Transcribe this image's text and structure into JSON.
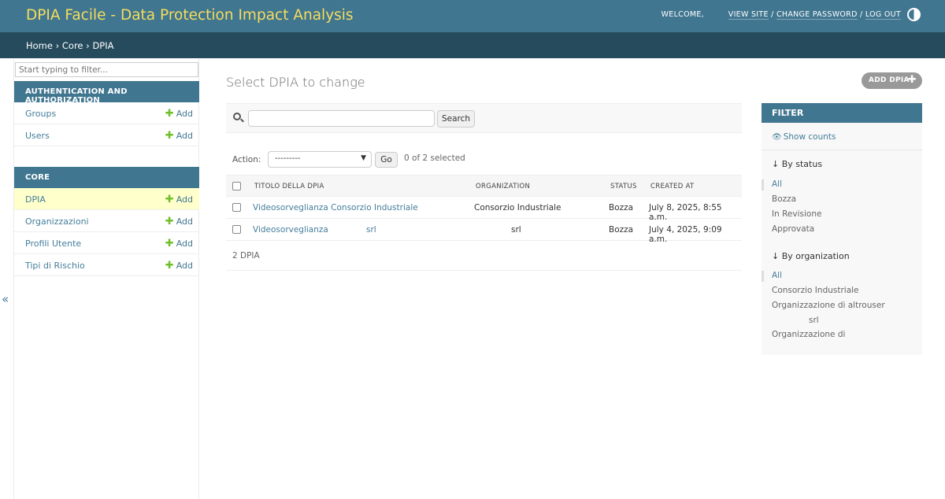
{
  "header": {
    "site_title": "DPIA Facile - Data Protection Impact Analysis",
    "welcome": "WELCOME,",
    "view_site": "VIEW SITE",
    "change_password": "CHANGE PASSWORD",
    "log_out": "LOG OUT",
    "separator": " / "
  },
  "breadcrumbs": {
    "home": "Home",
    "core": "Core",
    "current": "DPIA",
    "sep": " › "
  },
  "sidebar": {
    "filter_placeholder": "Start typing to filter...",
    "collapse": "«",
    "apps": [
      {
        "caption": "AUTHENTICATION AND AUTHORIZATION",
        "models": [
          {
            "name": "Groups",
            "add": "Add"
          },
          {
            "name": "Users",
            "add": "Add"
          }
        ]
      },
      {
        "caption": "CORE",
        "models": [
          {
            "name": "DPIA",
            "add": "Add"
          },
          {
            "name": "Organizzazioni",
            "add": "Add"
          },
          {
            "name": "Profili Utente",
            "add": "Add"
          },
          {
            "name": "Tipi di Rischio",
            "add": "Add"
          }
        ]
      }
    ]
  },
  "content": {
    "title": "Select DPIA to change",
    "add_button": "ADD DPIA",
    "search_button": "Search",
    "action_label": "Action:",
    "action_selected": "---------",
    "go_button": "Go",
    "selected_count": "0 of 2 selected",
    "columns": [
      "TITOLO DELLA DPIA",
      "ORGANIZATION",
      "STATUS",
      "CREATED AT"
    ],
    "rows": [
      {
        "title": "Videosorveglianza Consorzio Industriale",
        "title_extra": "",
        "organization": "Consorzio Industriale",
        "status": "Bozza",
        "created_at": "July 8, 2025, 8:55 a.m."
      },
      {
        "title": "Videosorveglianza",
        "title_extra": "srl",
        "organization": "srl",
        "status": "Bozza",
        "created_at": "July 4, 2025, 9:09 a.m."
      }
    ],
    "paginator": "2 DPIA"
  },
  "filter": {
    "header": "FILTER",
    "show_counts": "Show counts",
    "by_status_title": "↓ By status",
    "status_options": [
      "All",
      "Bozza",
      "In Revisione",
      "Approvata"
    ],
    "by_org_title": "↓ By organization",
    "org_options": [
      "All",
      "Consorzio Industriale",
      "Organizzazione di altrouser",
      "srl",
      "Organizzazione di"
    ]
  },
  "colors": {
    "header_bg": "#417690",
    "breadcrumb_bg": "#264b5d",
    "site_title": "#f5dd5d",
    "link": "#447e9b",
    "add_plus": "#70bf2b",
    "current_row": "#ffffcc"
  }
}
